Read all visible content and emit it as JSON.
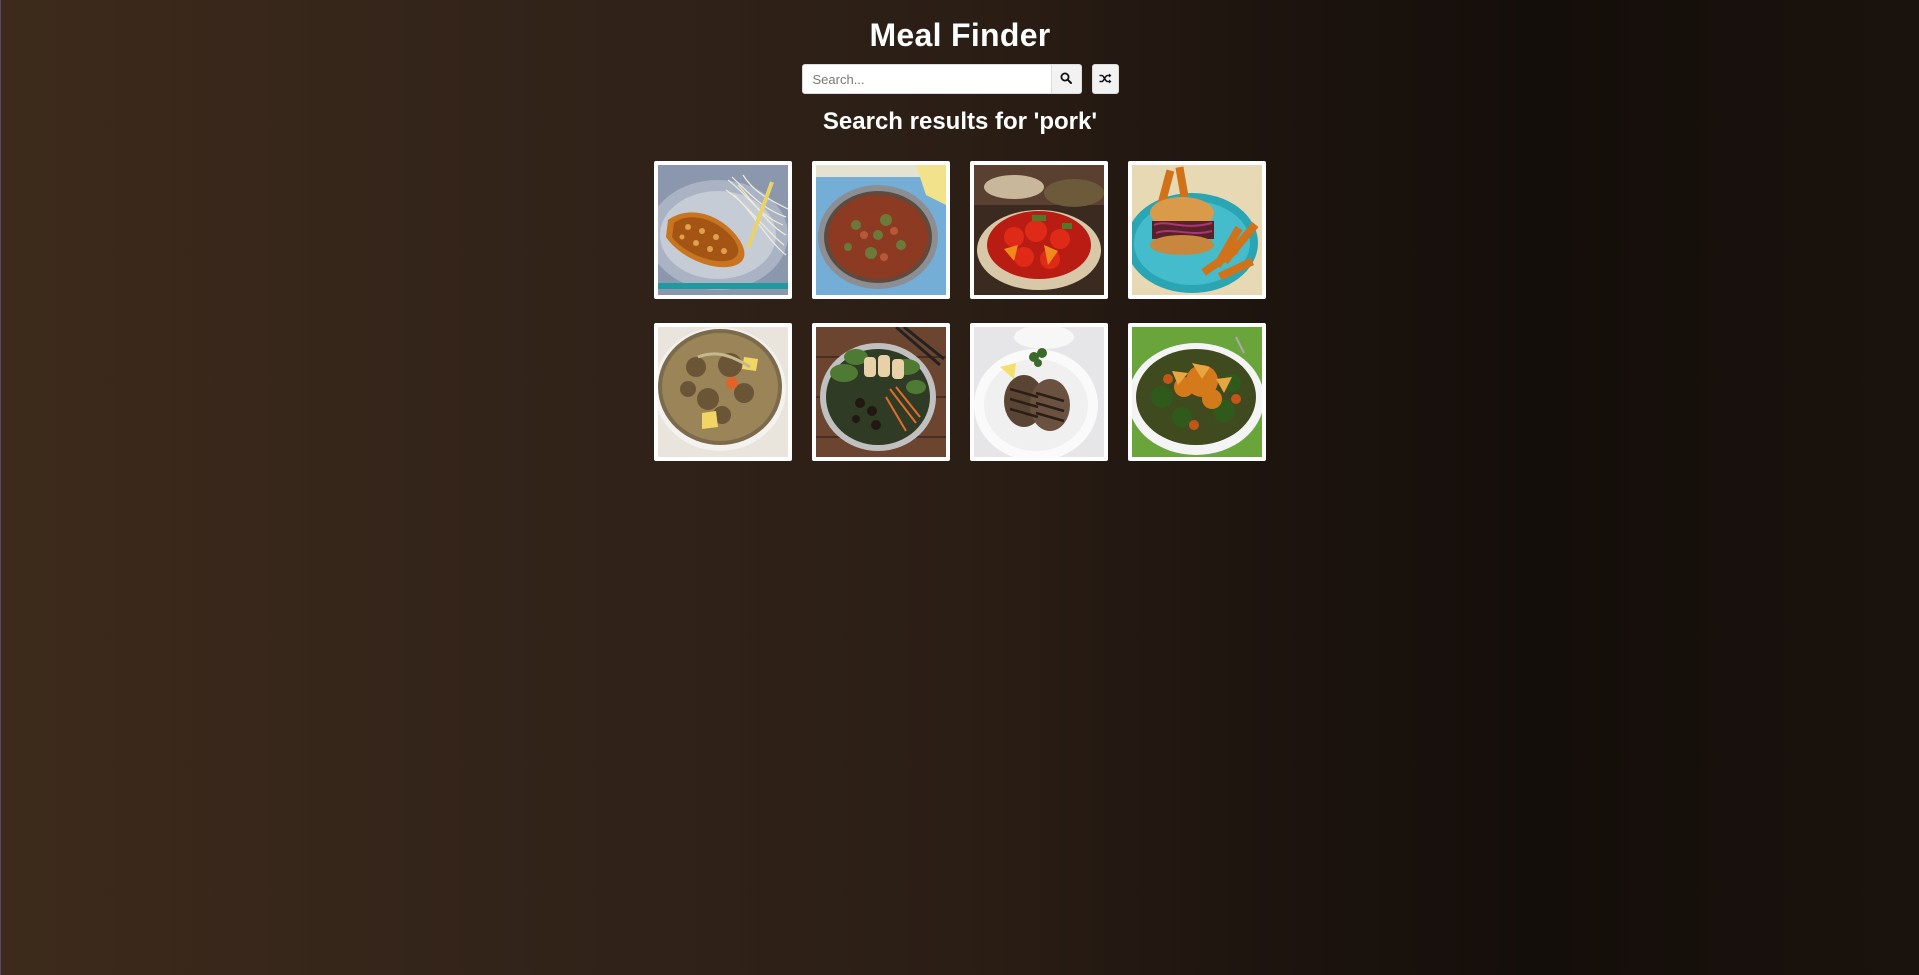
{
  "header": {
    "title": "Meal Finder"
  },
  "search": {
    "placeholder": "Search...",
    "value": "",
    "search_icon": "search-icon",
    "random_icon": "shuffle-icon"
  },
  "results": {
    "heading": "Search results for 'pork'"
  },
  "meals": [
    {
      "thumb": "breaded-pork-cutlet-with-noodles"
    },
    {
      "thumb": "pork-stew-in-skillet"
    },
    {
      "thumb": "sweet-and-sour-pork"
    },
    {
      "thumb": "pulled-pork-burger-with-fries"
    },
    {
      "thumb": "pork-and-potato-soup"
    },
    {
      "thumb": "vietnamese-pork-bowl"
    },
    {
      "thumb": "grilled-pork-chops-on-plate"
    },
    {
      "thumb": "pork-with-vegetables"
    }
  ],
  "colors": {
    "background_left": "#3d2a1b",
    "background_right": "#140e0a",
    "text": "#ffffff",
    "card_border": "#ffffff"
  }
}
